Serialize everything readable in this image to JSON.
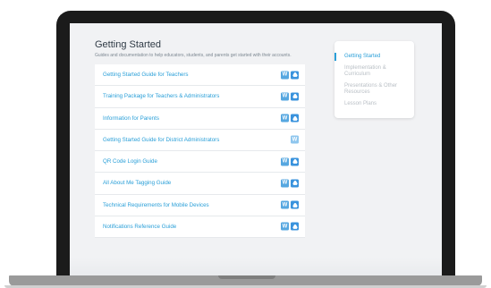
{
  "page": {
    "title": "Getting Started",
    "description": "Guides and documentation to help educators, students, and parents get started with their accounts."
  },
  "guides": [
    {
      "label": "Getting Started Guide for Teachers",
      "badges": [
        "W",
        "drive"
      ]
    },
    {
      "label": "Training Package for Teachers & Administrators",
      "badges": [
        "W",
        "drive"
      ]
    },
    {
      "label": "Information for Parents",
      "badges": [
        "W",
        "drive"
      ]
    },
    {
      "label": "Getting Started Guide for District Administrators",
      "badges": [
        "W"
      ]
    },
    {
      "label": "QR Code Login Guide",
      "badges": [
        "W",
        "drive"
      ]
    },
    {
      "label": "All About Me Tagging Guide",
      "badges": [
        "W",
        "drive"
      ]
    },
    {
      "label": "Technical Requirements for Mobile Devices",
      "badges": [
        "W",
        "drive"
      ]
    },
    {
      "label": "Notifications Reference Guide",
      "badges": [
        "W",
        "drive"
      ]
    }
  ],
  "side_nav": {
    "items": [
      {
        "label": "Getting Started",
        "active": true
      },
      {
        "label": "Implementation & Curriculum",
        "active": false
      },
      {
        "label": "Presentations & Other Resources",
        "active": false
      },
      {
        "label": "Lesson Plans",
        "active": false
      }
    ]
  },
  "badge_text": {
    "word": "W"
  },
  "colors": {
    "accent": "#2a9fd8",
    "badge_word": "#56a7e0",
    "badge_drive": "#3a93dd",
    "muted_text": "#b9bfc5",
    "bezel": "#1b1b1b",
    "screen_bg": "#f1f2f4"
  },
  "icons": {
    "word_badge": "word-doc-icon",
    "drive_badge": "google-drive-icon"
  }
}
